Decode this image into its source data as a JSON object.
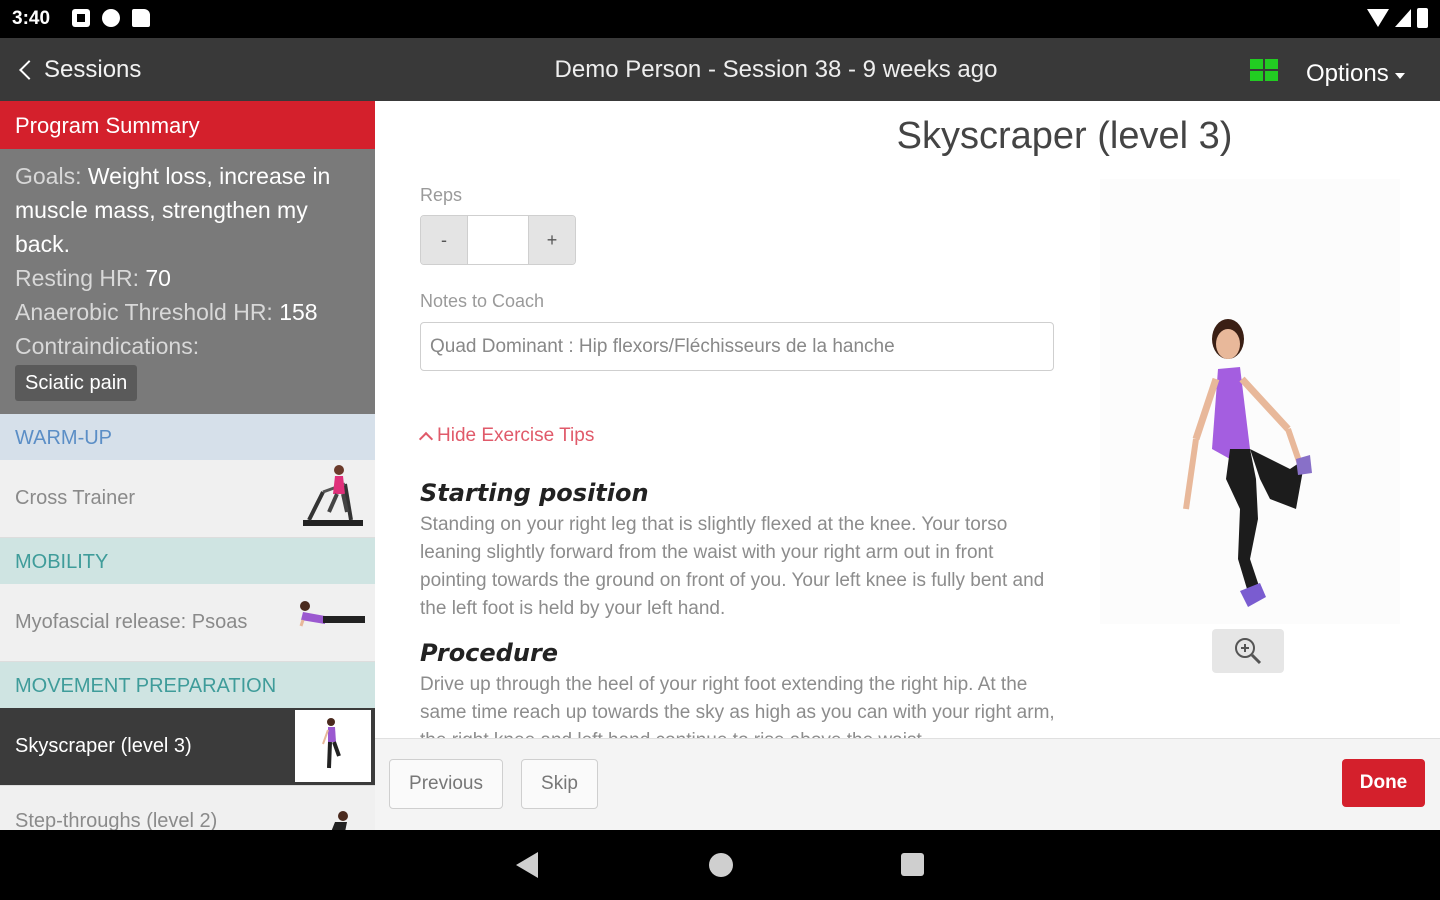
{
  "status": {
    "time": "3:40"
  },
  "appbar": {
    "back_label": "Sessions",
    "title": "Demo Person - Session 38 - 9 weeks ago",
    "options_label": "Options",
    "grid_color": "#22cc22"
  },
  "sidebar": {
    "header": "Program Summary",
    "summary": {
      "goals_label": "Goals:",
      "goals_value": "Weight loss, increase in muscle mass, strengthen my back.",
      "resting_label": "Resting HR:",
      "resting_value": "70",
      "anaerobic_label": "Anaerobic Threshold HR:",
      "anaerobic_value": "158",
      "contra_label": "Contraindications:",
      "contra_tag": "Sciatic pain"
    },
    "sections": [
      {
        "label": "WARM-UP",
        "items": [
          {
            "label": "Cross Trainer"
          }
        ]
      },
      {
        "label": "MOBILITY",
        "items": [
          {
            "label": "Myofascial release: Psoas"
          }
        ]
      },
      {
        "label": "MOVEMENT PREPARATION",
        "items": [
          {
            "label": "Skyscraper (level 3)",
            "active": true
          },
          {
            "label": "Step-throughs (level 2)"
          }
        ]
      }
    ]
  },
  "exercise": {
    "title": "Skyscraper (level 3)",
    "reps_label": "Reps",
    "reps_minus": "-",
    "reps_plus": "+",
    "reps_value": "",
    "notes_label": "Notes to Coach",
    "notes_value": "Quad Dominant : Hip flexors/Fléchisseurs de la hanche",
    "hide_tips_label": "Hide Exercise Tips",
    "tips": [
      {
        "heading": "Starting position",
        "text": "Standing on your right leg that is slightly flexed at the knee. Your torso leaning slightly forward from the waist with your right arm out in front pointing towards the ground on front of you. Your left knee is fully bent and the left foot is held by your left hand."
      },
      {
        "heading": "Procedure",
        "text": "Drive up through the heel of your right foot extending the right hip. At the same time reach up towards the sky as high as you can with your right arm, the right knee and left hand continue to rise above the waist."
      }
    ]
  },
  "actions": {
    "previous": "Previous",
    "skip": "Skip",
    "done": "Done"
  }
}
